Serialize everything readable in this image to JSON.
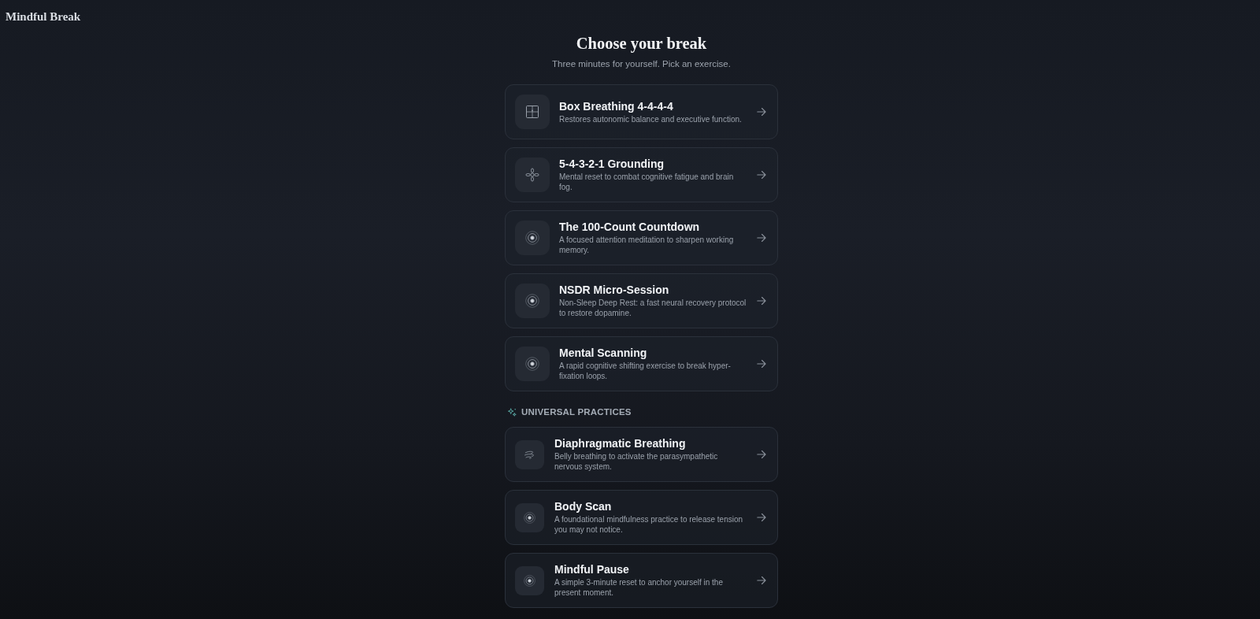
{
  "app": {
    "title": "Mindful Break"
  },
  "header": {
    "title": "Choose your break",
    "subtitle": "Three minutes for yourself. Pick an exercise."
  },
  "exercises": [
    {
      "kind": "square",
      "title": "Box Breathing 4-4-4-4",
      "description": "Restores autonomic balance and executive function."
    },
    {
      "kind": "petals",
      "title": "5-4-3-2-1 Grounding",
      "description": "Mental reset to combat cognitive fatigue and brain fog."
    },
    {
      "kind": "rings",
      "title": "The 100-Count Countdown",
      "description": "A focused attention meditation to sharpen working memory."
    },
    {
      "kind": "rings",
      "title": "NSDR Micro-Session",
      "description": "Non-Sleep Deep Rest: a fast neural recovery protocol to restore dopamine."
    },
    {
      "kind": "rings",
      "title": "Mental Scanning",
      "description": "A rapid cognitive shifting exercise to break hyper-fixation loops."
    }
  ],
  "universal_practices": {
    "heading": "UNIVERSAL PRACTICES",
    "exercises": [
      {
        "kind": "wind",
        "title": "Diaphragmatic Breathing",
        "description": "Belly breathing to activate the parasympathetic nervous system."
      },
      {
        "kind": "rings",
        "title": "Body Scan",
        "description": "A foundational mindfulness practice to release tension you may not notice."
      },
      {
        "kind": "rings",
        "title": "Mindful Pause",
        "description": "A simple 3-minute reset to anchor yourself in the present moment."
      }
    ]
  }
}
